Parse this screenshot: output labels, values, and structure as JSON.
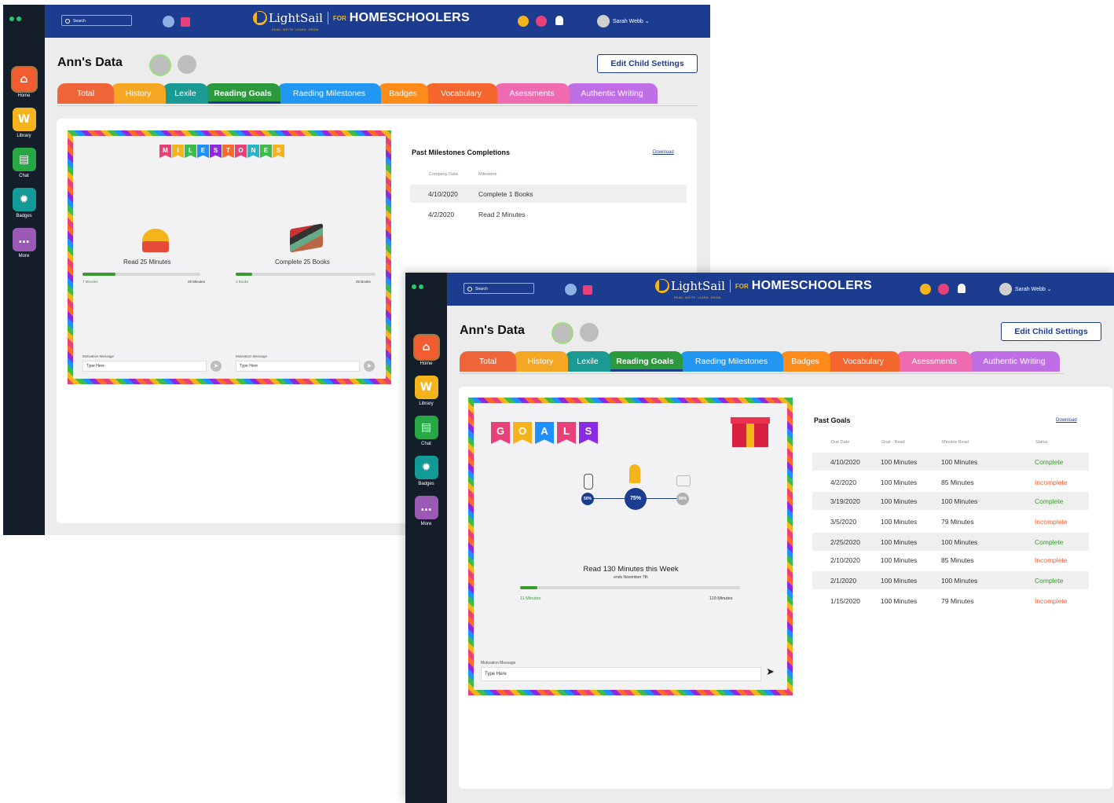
{
  "app": {
    "search_label": "Search",
    "brand_name": "LightSail",
    "brand_tagline": "READ. WRITE. LEARN. GROW.",
    "brand_for": "FOR",
    "brand_product": "HOMESCHOOLERS",
    "user_name": "Sarah Webb ⌄",
    "nav": [
      {
        "label": "Home",
        "icon": "home-icon",
        "color": "#f25c30",
        "glyph": "⌂"
      },
      {
        "label": "Library",
        "icon": "library-icon",
        "color": "#f5b41c",
        "glyph": "W"
      },
      {
        "label": "Chat",
        "icon": "chat-icon",
        "color": "#27a844",
        "glyph": "▤"
      },
      {
        "label": "Badges",
        "icon": "badge-icon",
        "color": "#129a99",
        "glyph": "✹"
      },
      {
        "label": "More",
        "icon": "more-icon",
        "color": "#9b59b6",
        "glyph": "…"
      }
    ],
    "page_title": "Ann's Data",
    "edit_button": "Edit Child Settings",
    "tabs": [
      {
        "label": "Total",
        "color": "#f0643a"
      },
      {
        "label": "History",
        "color": "#f5a623"
      },
      {
        "label": "Lexile",
        "color": "#1a9a93"
      },
      {
        "label": "Reading Goals",
        "color": "#2a9a3c"
      },
      {
        "label": "Raeding Milestones",
        "color": "#2196f3"
      },
      {
        "label": "Badges",
        "color": "#ff8c1a"
      },
      {
        "label": "Vocabulary",
        "color": "#f4662e"
      },
      {
        "label": "Asessments",
        "color": "#f06ab0"
      },
      {
        "label": "Authentic Writing",
        "color": "#c06ee6"
      }
    ],
    "active_tab": "Reading Goals"
  },
  "milestones_window": {
    "banner_letters": [
      "M",
      "I",
      "L",
      "E",
      "S",
      "T",
      "O",
      "N",
      "E",
      "S"
    ],
    "banner_colors": [
      "#e8417a",
      "#f5b41c",
      "#3dbb4b",
      "#1e90ff",
      "#8a2be2",
      "#ff6a2b",
      "#e8417a",
      "#2bb5c9",
      "#3dbb4b",
      "#f5b41c"
    ],
    "items": [
      {
        "label": "Read 25 Minutes",
        "icon": "reading-emoji-icon",
        "progress_left": "7 Minutes",
        "progress_right": "25 Minutes",
        "progress": 0.28
      },
      {
        "label": "Complete 25 Books",
        "icon": "books-stack-icon",
        "progress_left": "3 Books",
        "progress_right": "25 Books",
        "progress": 0.12
      }
    ],
    "motivation_label": "Motivation Message",
    "motivation_placeholder": "Type Here",
    "past_title": "Past Milestones Completions",
    "download": "Download",
    "columns": [
      "Company Data",
      "Milestone"
    ],
    "rows": [
      {
        "date": "4/10/2020",
        "milestone": "Complete 1 Books"
      },
      {
        "date": "4/2/2020",
        "milestone": "Read 2 Minutes"
      }
    ]
  },
  "goals_window": {
    "banner_letters": [
      "G",
      "O",
      "A",
      "L",
      "S"
    ],
    "banner_colors": [
      "#e8417a",
      "#f5b41c",
      "#1e90ff",
      "#e8417a",
      "#8a2be2"
    ],
    "nodes": [
      {
        "label": "50%",
        "icon": "boy-icon"
      },
      {
        "label": "75%",
        "icon": "rocket-icon"
      },
      {
        "label": "90%",
        "icon": "flying-icon"
      }
    ],
    "goal_text": "Read 130 Minutes this Week",
    "goal_sub": "ends November 7th",
    "progress_left": "11 Minutes",
    "progress_right": "119 Minutes",
    "progress": 0.08,
    "motivation_label": "Motivation Message",
    "motivation_placeholder": "Type Here",
    "past_title": "Past Goals",
    "download": "Download",
    "columns": [
      "Due Date",
      "Goal - Read",
      "Minutes Read",
      "Status"
    ],
    "rows": [
      {
        "date": "4/10/2020",
        "goal": "100 Minutes",
        "read": "100 Minutes",
        "status": "Complete"
      },
      {
        "date": "4/2/2020",
        "goal": "100 Minutes",
        "read": "85 Minutes",
        "status": "Incomplete"
      },
      {
        "date": "3/19/2020",
        "goal": "100 Minutes",
        "read": "100 Minutes",
        "status": "Complete"
      },
      {
        "date": "3/5/2020",
        "goal": "100 Minutes",
        "read": "79 Minutes",
        "status": "Incomplete"
      },
      {
        "date": "2/25/2020",
        "goal": "100 Minutes",
        "read": "100 Minutes",
        "status": "Complete"
      },
      {
        "date": "2/10/2020",
        "goal": "100 Minutes",
        "read": "85 Minutes",
        "status": "Incomplete"
      },
      {
        "date": "2/1/2020",
        "goal": "100 Minutes",
        "read": "100 Minutes",
        "status": "Complete"
      },
      {
        "date": "1/15/2020",
        "goal": "100 Minutes",
        "read": "79 Minutes",
        "status": "Incomplete"
      }
    ]
  }
}
